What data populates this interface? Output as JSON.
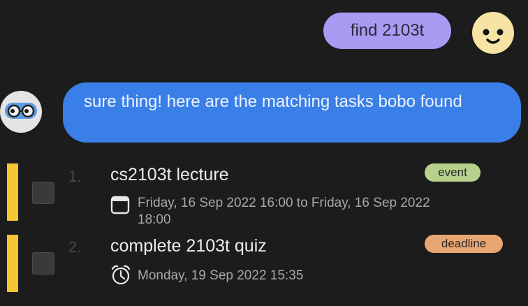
{
  "chat": {
    "user_message": "find 2103t",
    "bot_message": "sure thing! here are the matching tasks bobo found"
  },
  "tasks": [
    {
      "number": "1.",
      "title": "cs2103t lecture",
      "tag": "event",
      "tag_color": "#b6d18c",
      "icon": "calendar-icon",
      "date": "Friday, 16 Sep 2022 16:00 to Friday, 16 Sep 2022 18:00",
      "accent_color": "#f7c531"
    },
    {
      "number": "2.",
      "title": "complete 2103t quiz",
      "tag": "deadline",
      "tag_color": "#e8a673",
      "icon": "alarm-clock-icon",
      "date": "Monday, 19 Sep 2022 15:35",
      "accent_color": "#f7c531"
    }
  ]
}
